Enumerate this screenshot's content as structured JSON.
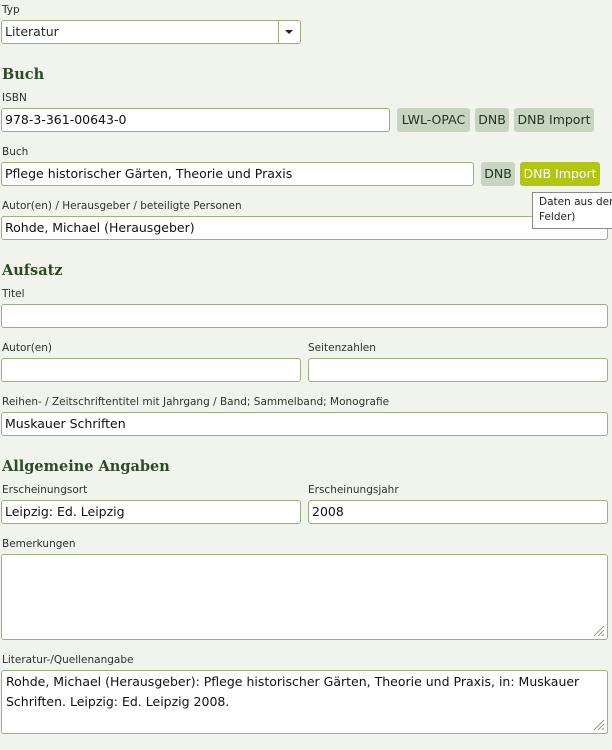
{
  "typ": {
    "label": "Typ",
    "value": "Literatur"
  },
  "buch_section": {
    "heading": "Buch",
    "isbn": {
      "label": "ISBN",
      "value": "978-3-361-00643-0"
    },
    "isbn_buttons": {
      "opac": "LWL-OPAC",
      "dnb": "DNB",
      "dnb_import": "DNB Import"
    },
    "buch": {
      "label": "Buch",
      "value": "Pflege historischer Gärten, Theorie und Praxis"
    },
    "buch_buttons": {
      "dnb": "DNB",
      "dnb_import": "DNB Import"
    },
    "tooltip": {
      "line1": "Daten aus der",
      "line2": "Felder)"
    },
    "autoren": {
      "label": "Autor(en) / Herausgeber / beteiligte Personen",
      "value": "Rohde, Michael (Herausgeber)"
    }
  },
  "aufsatz_section": {
    "heading": "Aufsatz",
    "titel": {
      "label": "Titel",
      "value": ""
    },
    "autoren": {
      "label": "Autor(en)",
      "value": ""
    },
    "seitenzahlen": {
      "label": "Seitenzahlen",
      "value": ""
    },
    "reihe": {
      "label": "Reihen- / Zeitschriftentitel mit Jahrgang / Band; Sammelband; Monografie",
      "value": "Muskauer Schriften"
    }
  },
  "allgemein_section": {
    "heading": "Allgemeine Angaben",
    "ort": {
      "label": "Erscheinungsort",
      "value": "Leipzig: Ed. Leipzig"
    },
    "jahr": {
      "label": "Erscheinungsjahr",
      "value": "2008"
    },
    "bemerkungen": {
      "label": "Bemerkungen",
      "value": ""
    },
    "quelle": {
      "label": "Literatur-/Quellenangabe",
      "value": "Rohde, Michael (Herausgeber): Pflege historischer Gärten, Theorie und Praxis, in: Muskauer Schriften. Leipzig: Ed. Leipzig 2008."
    }
  },
  "colors": {
    "accent": "#b3c514",
    "button": "#c7d4c2",
    "border": "#9bb27f",
    "heading": "#2e4a2a"
  }
}
